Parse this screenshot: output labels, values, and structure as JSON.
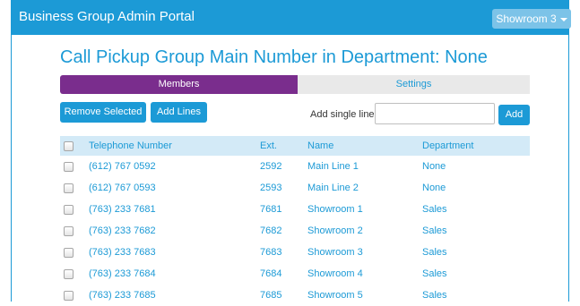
{
  "header": {
    "title": "Business Group Admin Portal",
    "location_button": "Showroom 3"
  },
  "page_title": "Call Pickup Group Main Number in Department: None",
  "tabs": [
    {
      "label": "Members",
      "active": true
    },
    {
      "label": "Settings",
      "active": false
    }
  ],
  "toolbar": {
    "remove_selected": "Remove Selected",
    "add_lines": "Add Lines",
    "single_line_label": "Add single line:",
    "single_line_value": "",
    "add": "Add"
  },
  "table": {
    "columns": [
      "Telephone Number",
      "Ext.",
      "Name",
      "Department"
    ],
    "rows": [
      {
        "phone": "(612) 767 0592",
        "ext": "2592",
        "name": "Main Line 1",
        "dept": "None"
      },
      {
        "phone": "(612) 767 0593",
        "ext": "2593",
        "name": "Main Line 2",
        "dept": "None"
      },
      {
        "phone": "(763) 233 7681",
        "ext": "7681",
        "name": "Showroom 1",
        "dept": "Sales"
      },
      {
        "phone": "(763) 233 7682",
        "ext": "7682",
        "name": "Showroom 2",
        "dept": "Sales"
      },
      {
        "phone": "(763) 233 7683",
        "ext": "7683",
        "name": "Showroom 3",
        "dept": "Sales"
      },
      {
        "phone": "(763) 233 7684",
        "ext": "7684",
        "name": "Showroom 4",
        "dept": "Sales"
      },
      {
        "phone": "(763) 233 7685",
        "ext": "7685",
        "name": "Showroom 5",
        "dept": "Sales"
      }
    ]
  },
  "colors": {
    "brand": "#1c9ad6",
    "active_tab": "#7a2d8d",
    "table_header": "#d3eaf7"
  }
}
